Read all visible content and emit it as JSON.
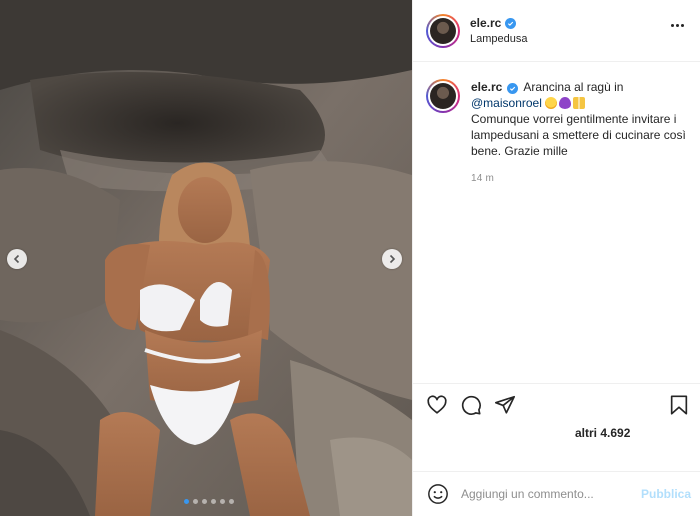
{
  "post": {
    "username": "ele.rc",
    "location": "Lampedusa",
    "verified": true,
    "caption": {
      "text_start": "Arancina al ragù in",
      "mention": "@maisonroel",
      "text_rest": "Comunque vorrei gentilmente invitare i lampedusani a smettere di cucinare così bene. Grazie mille",
      "timestamp": "14 m",
      "emojis": [
        "tongue-face-emoji",
        "purple-heart-emoji",
        "clinking-glasses-emoji"
      ]
    },
    "likes_label": "altri 4.692",
    "comment": {
      "placeholder": "Aggiungi un commento...",
      "post_label": "Pubblica"
    },
    "carousel": {
      "slide_count": 6,
      "active_index": 0
    }
  },
  "icons": {
    "like": "heart-icon",
    "comment": "comment-icon",
    "share": "share-icon",
    "save": "bookmark-icon",
    "emoji": "smiley-icon",
    "more": "more-options-icon",
    "prev": "chevron-left-icon",
    "next": "chevron-right-icon"
  },
  "colors": {
    "accent_blue": "#3897f0",
    "mention": "#00376b",
    "post_disabled": "#b2dffc",
    "muted": "#8e8e8e"
  }
}
